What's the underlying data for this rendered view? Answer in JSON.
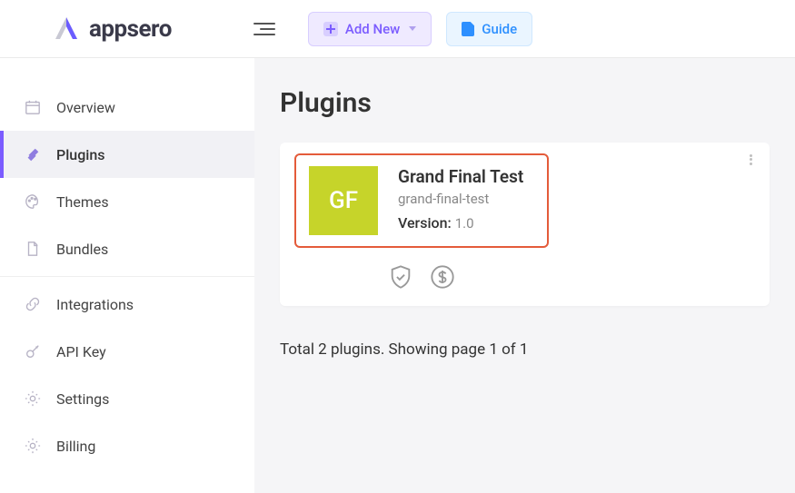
{
  "header": {
    "brand": "appsero",
    "add_new_label": "Add New",
    "guide_label": "Guide"
  },
  "sidebar": {
    "items": [
      {
        "label": "Overview"
      },
      {
        "label": "Plugins"
      },
      {
        "label": "Themes"
      },
      {
        "label": "Bundles"
      },
      {
        "label": "Integrations"
      },
      {
        "label": "API Key"
      },
      {
        "label": "Settings"
      },
      {
        "label": "Billing"
      }
    ]
  },
  "main": {
    "title": "Plugins",
    "plugin": {
      "initials": "GF",
      "name": "Grand Final Test",
      "slug": "grand-final-test",
      "version_label": "Version:",
      "version_value": "1.0"
    },
    "footer": "Total 2 plugins. Showing page 1 of 1"
  }
}
